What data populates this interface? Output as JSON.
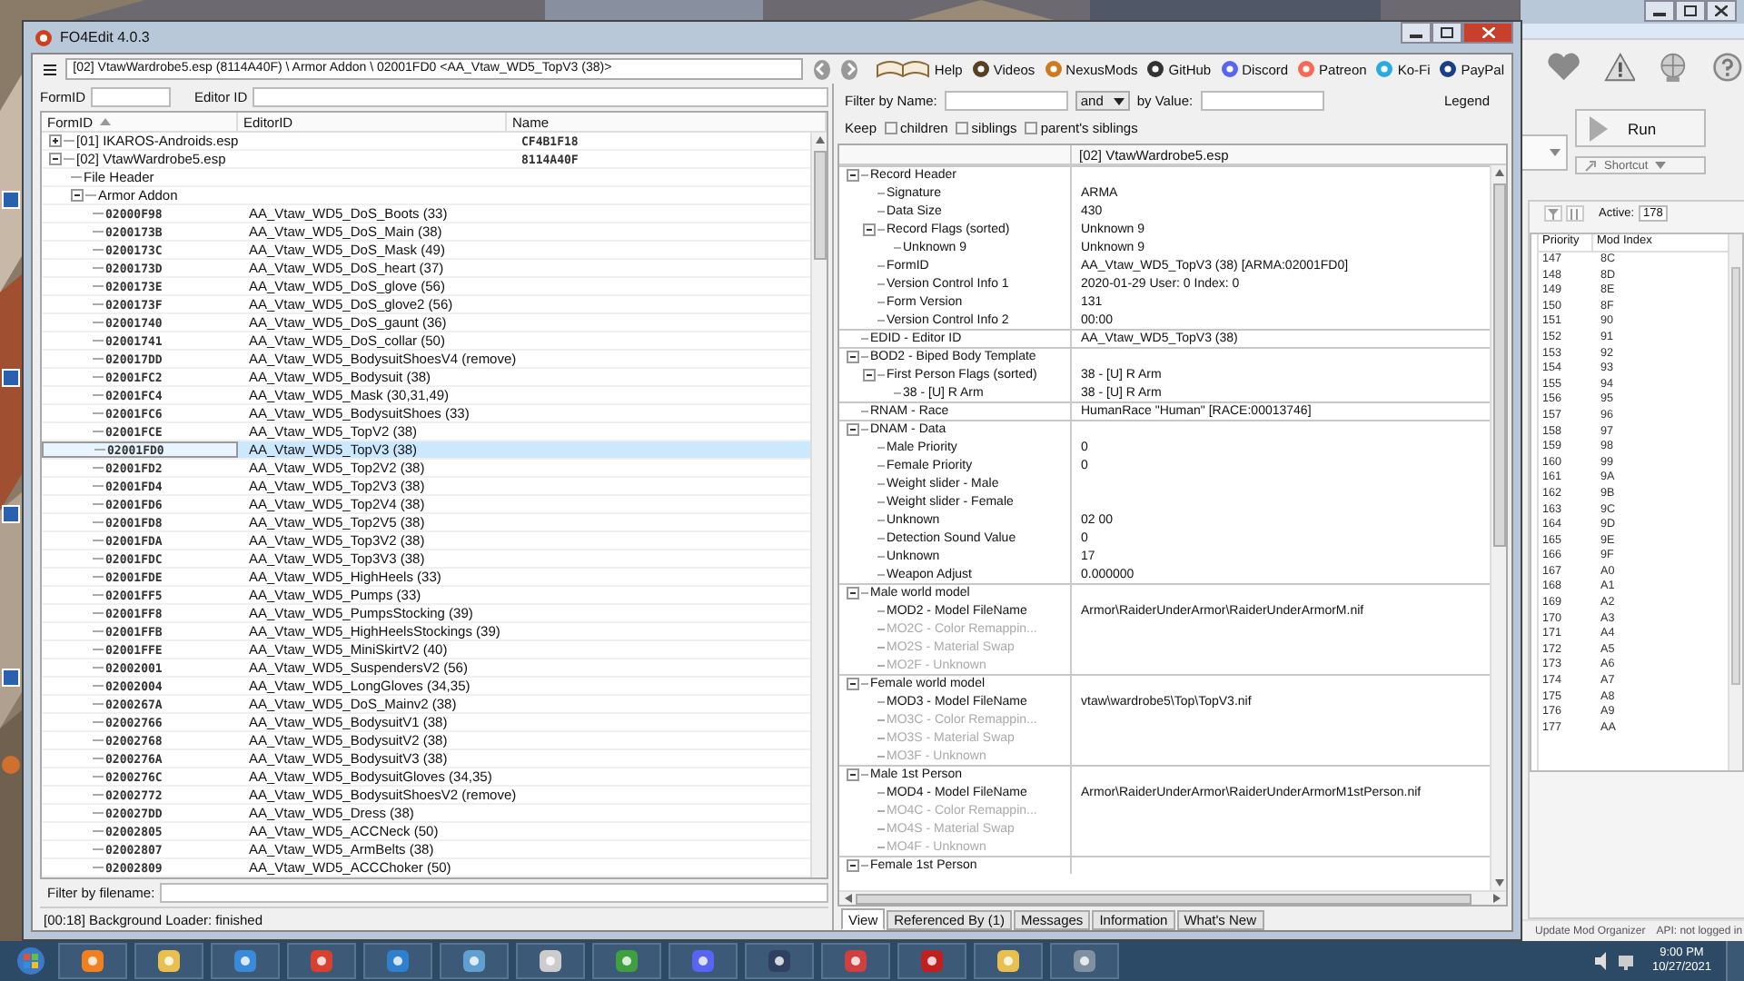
{
  "fo4edit": {
    "title": "FO4Edit 4.0.3",
    "path": "[02] VtawWardrobe5.esp (8114A40F) \\ Armor Addon \\ 02001FD0 <AA_Vtaw_WD5_TopV3 (38)>",
    "links": [
      {
        "label": "Help"
      },
      {
        "label": "Videos"
      },
      {
        "label": "NexusMods"
      },
      {
        "label": "GitHub"
      },
      {
        "label": "Discord"
      },
      {
        "label": "Patreon"
      },
      {
        "label": "Ko-Fi"
      },
      {
        "label": "PayPal"
      }
    ],
    "form_id_label": "FormID",
    "editor_id_label": "Editor ID",
    "tree": {
      "columns": [
        "FormID",
        "EditorID",
        "Name"
      ],
      "rows": [
        {
          "form_id": "[01] IKAROS-Androids.esp",
          "name": "CF4B1F18",
          "expanded": false
        },
        {
          "form_id": "[02] VtawWardrobe5.esp",
          "name": "8114A40F",
          "expanded": true,
          "children": [
            {
              "form_id": "File Header"
            },
            {
              "form_id": "Armor Addon",
              "expanded": true,
              "children": [
                {
                  "form_id": "02000F98",
                  "editor_id": "AA_Vtaw_WD5_DoS_Boots (33)",
                  "selected": false
                },
                {
                  "form_id": "0200173B",
                  "editor_id": "AA_Vtaw_WD5_DoS_Main (38)",
                  "selected": false
                },
                {
                  "form_id": "0200173C",
                  "editor_id": "AA_Vtaw_WD5_DoS_Mask (49)",
                  "selected": false
                },
                {
                  "form_id": "0200173D",
                  "editor_id": "AA_Vtaw_WD5_DoS_heart (37)",
                  "selected": false
                },
                {
                  "form_id": "0200173E",
                  "editor_id": "AA_Vtaw_WD5_DoS_glove (56)",
                  "selected": false
                },
                {
                  "form_id": "0200173F",
                  "editor_id": "AA_Vtaw_WD5_DoS_glove2 (56)",
                  "selected": false
                },
                {
                  "form_id": "02001740",
                  "editor_id": "AA_Vtaw_WD5_DoS_gaunt (36)",
                  "selected": false
                },
                {
                  "form_id": "02001741",
                  "editor_id": "AA_Vtaw_WD5_DoS_collar (50)",
                  "selected": false
                },
                {
                  "form_id": "020017DD",
                  "editor_id": "AA_Vtaw_WD5_BodysuitShoesV4 (remove)",
                  "selected": false
                },
                {
                  "form_id": "02001FC2",
                  "editor_id": "AA_Vtaw_WD5_Bodysuit (38)",
                  "selected": false
                },
                {
                  "form_id": "02001FC4",
                  "editor_id": "AA_Vtaw_WD5_Mask (30,31,49)",
                  "selected": false
                },
                {
                  "form_id": "02001FC6",
                  "editor_id": "AA_Vtaw_WD5_BodysuitShoes (33)",
                  "selected": false
                },
                {
                  "form_id": "02001FCE",
                  "editor_id": "AA_Vtaw_WD5_TopV2 (38)",
                  "selected": false
                },
                {
                  "form_id": "02001FD0",
                  "editor_id": "AA_Vtaw_WD5_TopV3 (38)",
                  "selected": true
                },
                {
                  "form_id": "02001FD2",
                  "editor_id": "AA_Vtaw_WD5_Top2V2 (38)",
                  "selected": false
                },
                {
                  "form_id": "02001FD4",
                  "editor_id": "AA_Vtaw_WD5_Top2V3 (38)",
                  "selected": false
                },
                {
                  "form_id": "02001FD6",
                  "editor_id": "AA_Vtaw_WD5_Top2V4 (38)",
                  "selected": false
                },
                {
                  "form_id": "02001FD8",
                  "editor_id": "AA_Vtaw_WD5_Top2V5 (38)",
                  "selected": false
                },
                {
                  "form_id": "02001FDA",
                  "editor_id": "AA_Vtaw_WD5_Top3V2 (38)",
                  "selected": false
                },
                {
                  "form_id": "02001FDC",
                  "editor_id": "AA_Vtaw_WD5_Top3V3 (38)",
                  "selected": false
                },
                {
                  "form_id": "02001FDE",
                  "editor_id": "AA_Vtaw_WD5_HighHeels (33)",
                  "selected": false
                },
                {
                  "form_id": "02001FF5",
                  "editor_id": "AA_Vtaw_WD5_Pumps (33)",
                  "selected": false
                },
                {
                  "form_id": "02001FF8",
                  "editor_id": "AA_Vtaw_WD5_PumpsStocking (39)",
                  "selected": false
                },
                {
                  "form_id": "02001FFB",
                  "editor_id": "AA_Vtaw_WD5_HighHeelsStockings (39)",
                  "selected": false
                },
                {
                  "form_id": "02001FFE",
                  "editor_id": "AA_Vtaw_WD5_MiniSkirtV2 (40)",
                  "selected": false
                },
                {
                  "form_id": "02002001",
                  "editor_id": "AA_Vtaw_WD5_SuspendersV2 (56)",
                  "selected": false
                },
                {
                  "form_id": "02002004",
                  "editor_id": "AA_Vtaw_WD5_LongGloves (34,35)",
                  "selected": false
                },
                {
                  "form_id": "0200267A",
                  "editor_id": "AA_Vtaw_WD5_DoS_Mainv2 (38)",
                  "selected": false
                },
                {
                  "form_id": "02002766",
                  "editor_id": "AA_Vtaw_WD5_BodysuitV1 (38)",
                  "selected": false
                },
                {
                  "form_id": "02002768",
                  "editor_id": "AA_Vtaw_WD5_BodysuitV2 (38)",
                  "selected": false
                },
                {
                  "form_id": "0200276A",
                  "editor_id": "AA_Vtaw_WD5_BodysuitV3 (38)",
                  "selected": false
                },
                {
                  "form_id": "0200276C",
                  "editor_id": "AA_Vtaw_WD5_BodysuitGloves (34,35)",
                  "selected": false
                },
                {
                  "form_id": "02002772",
                  "editor_id": "AA_Vtaw_WD5_BodysuitShoesV2 (remove)",
                  "selected": false
                },
                {
                  "form_id": "020027DD",
                  "editor_id": "AA_Vtaw_WD5_Dress (38)",
                  "selected": false
                },
                {
                  "form_id": "02002805",
                  "editor_id": "AA_Vtaw_WD5_ACCNeck (50)",
                  "selected": false
                },
                {
                  "form_id": "02002807",
                  "editor_id": "AA_Vtaw_WD5_ArmBelts (38)",
                  "selected": false
                },
                {
                  "form_id": "02002809",
                  "editor_id": "AA_Vtaw_WD5_ACCChoker (50)",
                  "selected": false
                }
              ]
            }
          ]
        }
      ]
    },
    "filename_filter_label": "Filter by filename:",
    "status": "[00:18] Background Loader: finished",
    "filter_name_label": "Filter by Name:",
    "filter_operator": "and",
    "filter_value_label": "by Value:",
    "legend": "Legend",
    "keep_label": "Keep",
    "keep_options": [
      {
        "label": "children",
        "checked": false
      },
      {
        "label": "siblings",
        "checked": false
      },
      {
        "label": "parent's siblings",
        "checked": false
      }
    ],
    "view_header": "[02] VtawWardrobe5.esp",
    "view_rows": [
      {
        "label": "Record Header",
        "expanded": true,
        "disabled": false,
        "children": [
          {
            "label": "Signature",
            "value": "ARMA",
            "disabled": false
          },
          {
            "label": "Data Size",
            "value": "430",
            "disabled": false
          },
          {
            "label": "Record Flags (sorted)",
            "value": "Unknown 9",
            "expanded": true,
            "disabled": false,
            "children": [
              {
                "label": "Unknown 9",
                "value": "Unknown 9",
                "disabled": false
              }
            ]
          },
          {
            "label": "FormID",
            "value": "AA_Vtaw_WD5_TopV3 (38) [ARMA:02001FD0]",
            "disabled": false
          },
          {
            "label": "Version Control Info 1",
            "value": "2020-01-29 User: 0 Index: 0",
            "disabled": false
          },
          {
            "label": "Form Version",
            "value": "131",
            "disabled": false
          },
          {
            "label": "Version Control Info 2",
            "value": "00:00",
            "disabled": false
          }
        ]
      },
      {
        "label": "EDID - Editor ID",
        "value": "AA_Vtaw_WD5_TopV3 (38)",
        "disabled": false
      },
      {
        "label": "BOD2 - Biped Body Template",
        "expanded": true,
        "disabled": false,
        "children": [
          {
            "label": "First Person Flags (sorted)",
            "value": "38 - [U] R Arm",
            "expanded": true,
            "disabled": false,
            "children": [
              {
                "label": "38 - [U] R Arm",
                "value": "38 - [U] R Arm",
                "disabled": false
              }
            ]
          }
        ]
      },
      {
        "label": "RNAM - Race",
        "value": "HumanRace \"Human\" [RACE:00013746]",
        "disabled": false
      },
      {
        "label": "DNAM - Data",
        "expanded": true,
        "disabled": false,
        "children": [
          {
            "label": "Male Priority",
            "value": "0",
            "disabled": false
          },
          {
            "label": "Female Priority",
            "value": "0",
            "disabled": false
          },
          {
            "label": "Weight slider - Male",
            "disabled": false
          },
          {
            "label": "Weight slider - Female",
            "disabled": false
          },
          {
            "label": "Unknown",
            "value": "02 00",
            "disabled": false
          },
          {
            "label": "Detection Sound Value",
            "value": "0",
            "disabled": false
          },
          {
            "label": "Unknown",
            "value": "17",
            "disabled": false
          },
          {
            "label": "Weapon Adjust",
            "value": "0.000000",
            "disabled": false
          }
        ]
      },
      {
        "label": "Male world model",
        "expanded": true,
        "disabled": false,
        "children": [
          {
            "label": "MOD2 - Model FileName",
            "value": "Armor\\RaiderUnderArmor\\RaiderUnderArmorM.nif",
            "disabled": false
          },
          {
            "label": "MO2C - Color Remappin...",
            "disabled": true
          },
          {
            "label": "MO2S - Material Swap",
            "disabled": true
          },
          {
            "label": "MO2F - Unknown",
            "disabled": true
          }
        ]
      },
      {
        "label": "Female world model",
        "expanded": true,
        "disabled": false,
        "children": [
          {
            "label": "MOD3 - Model FileName",
            "value": "vtaw\\wardrobe5\\Top\\TopV3.nif",
            "disabled": false
          },
          {
            "label": "MO3C - Color Remappin...",
            "disabled": true
          },
          {
            "label": "MO3S - Material Swap",
            "disabled": true
          },
          {
            "label": "MO3F - Unknown",
            "disabled": true
          }
        ]
      },
      {
        "label": "Male 1st Person",
        "expanded": true,
        "disabled": false,
        "children": [
          {
            "label": "MOD4 - Model FileName",
            "value": "Armor\\RaiderUnderArmor\\RaiderUnderArmorM1stPerson.nif",
            "disabled": false
          },
          {
            "label": "MO4C - Color Remappin...",
            "disabled": true
          },
          {
            "label": "MO4S - Material Swap",
            "disabled": true
          },
          {
            "label": "MO4F - Unknown",
            "disabled": true
          }
        ]
      },
      {
        "label": "Female 1st Person",
        "expanded": true,
        "disabled": false
      }
    ],
    "tabs": [
      {
        "label": "View",
        "selected": true
      },
      {
        "label": "Referenced By (1)",
        "selected": false
      },
      {
        "label": "Messages",
        "selected": false
      },
      {
        "label": "Information",
        "selected": false
      },
      {
        "label": "What's New",
        "selected": false
      }
    ]
  },
  "mo2": {
    "run_label": "Run",
    "shortcut_label": "Shortcut",
    "active_label": "Active:",
    "active_count": "178",
    "columns": [
      "Priority",
      "Mod Index"
    ],
    "rows": [
      {
        "priority": "147",
        "mod_index": "8C"
      },
      {
        "priority": "148",
        "mod_index": "8D"
      },
      {
        "priority": "149",
        "mod_index": "8E"
      },
      {
        "priority": "150",
        "mod_index": "8F"
      },
      {
        "priority": "151",
        "mod_index": "90"
      },
      {
        "priority": "152",
        "mod_index": "91"
      },
      {
        "priority": "153",
        "mod_index": "92"
      },
      {
        "priority": "154",
        "mod_index": "93"
      },
      {
        "priority": "155",
        "mod_index": "94"
      },
      {
        "priority": "156",
        "mod_index": "95"
      },
      {
        "priority": "157",
        "mod_index": "96"
      },
      {
        "priority": "158",
        "mod_index": "97"
      },
      {
        "priority": "159",
        "mod_index": "98"
      },
      {
        "priority": "160",
        "mod_index": "99"
      },
      {
        "priority": "161",
        "mod_index": "9A"
      },
      {
        "priority": "162",
        "mod_index": "9B"
      },
      {
        "priority": "163",
        "mod_index": "9C"
      },
      {
        "priority": "164",
        "mod_index": "9D"
      },
      {
        "priority": "165",
        "mod_index": "9E"
      },
      {
        "priority": "166",
        "mod_index": "9F"
      },
      {
        "priority": "167",
        "mod_index": "A0"
      },
      {
        "priority": "168",
        "mod_index": "A1"
      },
      {
        "priority": "169",
        "mod_index": "A2"
      },
      {
        "priority": "170",
        "mod_index": "A3"
      },
      {
        "priority": "171",
        "mod_index": "A4"
      },
      {
        "priority": "172",
        "mod_index": "A5"
      },
      {
        "priority": "173",
        "mod_index": "A6"
      },
      {
        "priority": "174",
        "mod_index": "A7"
      },
      {
        "priority": "175",
        "mod_index": "A8"
      },
      {
        "priority": "176",
        "mod_index": "A9"
      },
      {
        "priority": "177",
        "mod_index": "AA"
      }
    ],
    "status": [
      "Update Mod Organizer",
      "API: not logged in"
    ]
  },
  "taskbar": {
    "time": "9:00 PM",
    "date": "10/27/2021"
  }
}
